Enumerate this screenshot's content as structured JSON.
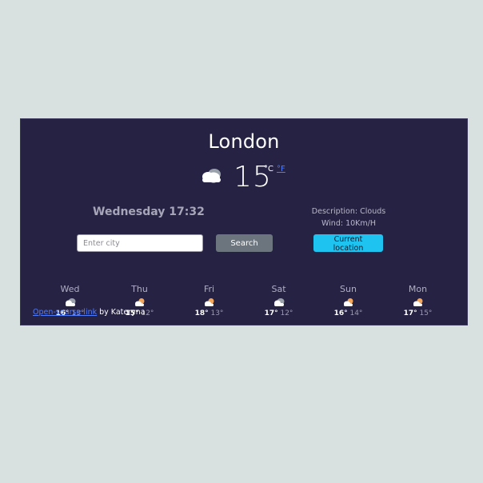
{
  "city": "London",
  "current": {
    "icon": "cloud-icon",
    "temperature": "15",
    "unit_celsius": "°C",
    "unit_fahrenheit": "°F",
    "datetime": "Wednesday 17:32",
    "description": "Description: Clouds",
    "wind": "Wind: 10Km/H"
  },
  "search": {
    "placeholder": "Enter city",
    "search_label": "Search",
    "location_label": "Current location"
  },
  "forecast": [
    {
      "day": "Wed",
      "icon": "cloud-icon",
      "max": "16°",
      "min": "13°"
    },
    {
      "day": "Thu",
      "icon": "sun-cloud-icon",
      "max": "15°",
      "min": "12°"
    },
    {
      "day": "Fri",
      "icon": "sun-cloud-icon",
      "max": "18°",
      "min": "13°"
    },
    {
      "day": "Sat",
      "icon": "cloud-icon",
      "max": "17°",
      "min": "12°"
    },
    {
      "day": "Sun",
      "icon": "sun-cloud-icon",
      "max": "16°",
      "min": "14°"
    },
    {
      "day": "Mon",
      "icon": "sun-cloud-icon",
      "max": "17°",
      "min": "15°"
    }
  ],
  "footer": {
    "link_text": "Open-sourse link",
    "suffix": " by Kateryna"
  }
}
